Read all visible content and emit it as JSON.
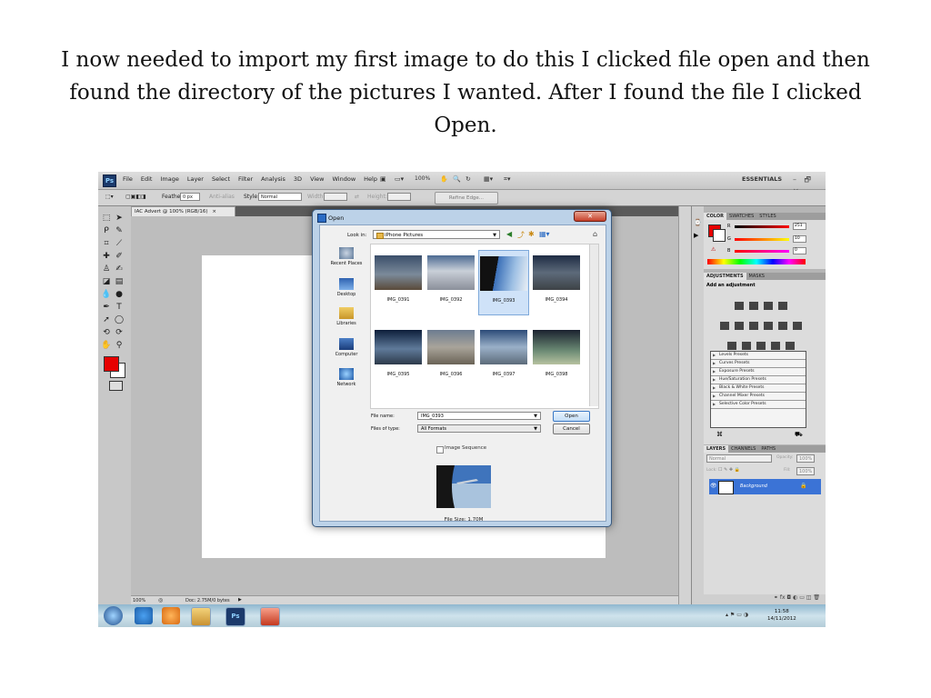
{
  "caption": {
    "line1": "I now needed to import my first image to do this I clicked file open and then",
    "line2": "found the directory of the pictures I wanted. After I found the file I clicked",
    "line3": "Open."
  },
  "app": {
    "logo": "Ps",
    "menu": [
      "File",
      "Edit",
      "Image",
      "Layer",
      "Select",
      "Filter",
      "Analysis",
      "3D",
      "View",
      "Window",
      "Help"
    ],
    "zoom_menu": "100%",
    "workspace": "ESSENTIALS",
    "window_controls": "– 🗗 ✕"
  },
  "options_bar": {
    "feather_label": "Feather:",
    "feather_value": "0 px",
    "antialias_label": "Anti-alias",
    "style_label": "Style:",
    "style_value": "Normal",
    "width_label": "Width:",
    "height_label": "Height:",
    "refine_edge": "Refine Edge..."
  },
  "document": {
    "tab_title": "IAC Advert @ 100% (RGB/16)",
    "tab_close": "×",
    "status_zoom": "100%",
    "status_doc": "Doc: 2.75M/0 bytes"
  },
  "colors": {
    "foreground": "#e60000",
    "background": "#ffffff",
    "accent_selection": "#3b73d6"
  },
  "color_panel": {
    "tabs": [
      "COLOR",
      "SWATCHES",
      "STYLES"
    ],
    "r_label": "R",
    "g_label": "G",
    "b_label": "B",
    "r_value": "251",
    "g_value": "10",
    "b_value": "0"
  },
  "adjustments_panel": {
    "tabs": [
      "ADJUSTMENTS",
      "MASKS"
    ],
    "header": "Add an adjustment",
    "presets": [
      "Levels Presets",
      "Curves Presets",
      "Exposure Presets",
      "Hue/Saturation Presets",
      "Black & White Presets",
      "Channel Mixer Presets",
      "Selective Color Presets"
    ]
  },
  "layers_panel": {
    "tabs": [
      "LAYERS",
      "CHANNELS",
      "PATHS"
    ],
    "blend_mode": "Normal",
    "opacity_label": "Opacity:",
    "opacity_value": "100%",
    "lock_label": "Lock:",
    "fill_label": "Fill:",
    "fill_value": "100%",
    "layer_name": "Background"
  },
  "open_dialog": {
    "title": "Open",
    "close": "✕",
    "look_in_label": "Look in:",
    "look_in_value": "iPhone Pictures",
    "places": [
      "Recent Places",
      "Desktop",
      "Libraries",
      "Computer",
      "Network"
    ],
    "files": [
      "IMG_0391",
      "IMG_0392",
      "IMG_0393",
      "IMG_0394",
      "IMG_0395",
      "IMG_0396",
      "IMG_0397",
      "IMG_0398"
    ],
    "selected_file": "IMG_0393",
    "file_name_label": "File name:",
    "file_name_value": "IMG_0393",
    "file_type_label": "Files of type:",
    "file_type_value": "All Formats",
    "open_button": "Open",
    "cancel_button": "Cancel",
    "image_sequence_label": "Image Sequence",
    "file_size": "File Size: 1.70M"
  },
  "taskbar": {
    "time": "11:58",
    "date": "14/11/2012",
    "ps_label": "Ps"
  }
}
